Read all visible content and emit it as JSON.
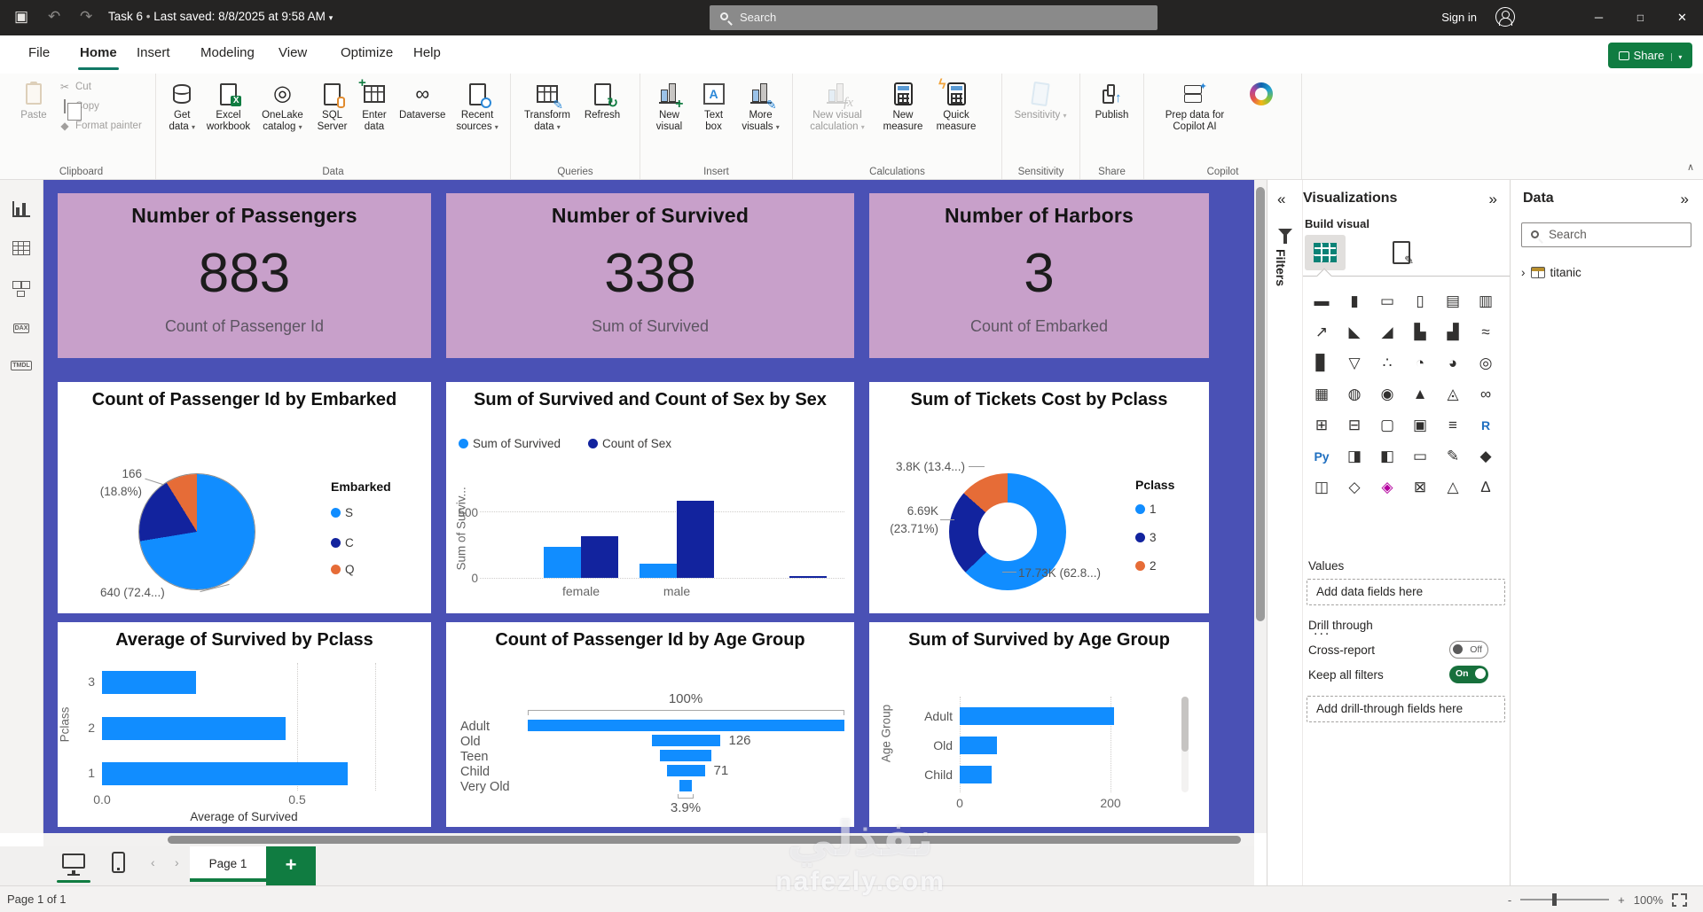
{
  "titlebar": {
    "doc_title": "Task 6",
    "separator": "•",
    "last_saved": "Last saved: 8/8/2025 at 9:58 AM",
    "search_placeholder": "Search",
    "sign_in": "Sign in"
  },
  "menubar": {
    "items": [
      "File",
      "Home",
      "Insert",
      "Modeling",
      "View",
      "Optimize",
      "Help"
    ],
    "active": "Home",
    "share_label": "Share"
  },
  "ribbon": {
    "groups": [
      {
        "label": "Clipboard",
        "buttons": [
          {
            "label": "Paste",
            "icon": "paste",
            "disabled": true
          }
        ],
        "small": [
          {
            "label": "Cut",
            "icon": "cut"
          },
          {
            "label": "Copy",
            "icon": "copy"
          },
          {
            "label": "Format painter",
            "icon": "brush"
          }
        ]
      },
      {
        "label": "Data",
        "buttons": [
          {
            "label": "Get data",
            "icon": "db",
            "caret": true
          },
          {
            "label": "Excel workbook",
            "icon": "excel"
          },
          {
            "label": "OneLake catalog",
            "icon": "onelake",
            "caret": true
          },
          {
            "label": "SQL Server",
            "icon": "sql"
          },
          {
            "label": "Enter data",
            "icon": "enter"
          },
          {
            "label": "Dataverse",
            "icon": "dataverse"
          },
          {
            "label": "Recent sources",
            "icon": "recent",
            "caret": true
          }
        ]
      },
      {
        "label": "Queries",
        "buttons": [
          {
            "label": "Transform data",
            "icon": "transform",
            "caret": true
          },
          {
            "label": "Refresh",
            "icon": "refresh"
          }
        ]
      },
      {
        "label": "Insert",
        "buttons": [
          {
            "label": "New visual",
            "icon": "newvisual"
          },
          {
            "label": "Text box",
            "icon": "textbox"
          },
          {
            "label": "More visuals",
            "icon": "morevis",
            "caret": true
          }
        ]
      },
      {
        "label": "Calculations",
        "buttons": [
          {
            "label": "New visual calculation",
            "icon": "fx",
            "caret": true,
            "disabled": true
          },
          {
            "label": "New measure",
            "icon": "calc"
          },
          {
            "label": "Quick measure",
            "icon": "quick"
          }
        ]
      },
      {
        "label": "Sensitivity",
        "buttons": [
          {
            "label": "Sensitivity",
            "icon": "tag",
            "caret": true,
            "disabled": true
          }
        ]
      },
      {
        "label": "Share",
        "buttons": [
          {
            "label": "Publish",
            "icon": "publish"
          }
        ]
      },
      {
        "label": "Copilot",
        "buttons": [
          {
            "label": "Prep data for Copilot AI",
            "icon": "prep"
          },
          {
            "label": "",
            "icon": "copilot"
          }
        ]
      }
    ]
  },
  "sidebar": {
    "views": [
      "report-view",
      "table-view",
      "model-view",
      "dax-query-view",
      "tmdl-view"
    ],
    "active": "report-view",
    "dax_tag": "DAX",
    "tmdl_tag": "TMDL"
  },
  "cards": [
    {
      "title": "Number of Passengers",
      "value": "883",
      "subtitle": "Count of Passenger Id"
    },
    {
      "title": "Number of Survived",
      "value": "338",
      "subtitle": "Sum of Survived"
    },
    {
      "title": "Number of Harbors",
      "value": "3",
      "subtitle": "Count of Embarked"
    }
  ],
  "chart_data": [
    {
      "type": "pie",
      "title": "Count of Passenger Id by Embarked",
      "legend_title": "Embarked",
      "legend_position": "right",
      "categories": [
        "S",
        "C",
        "Q"
      ],
      "values": [
        640,
        166,
        77
      ],
      "percents": [
        72.4,
        18.8,
        8.8
      ],
      "colors": [
        "#118DFF",
        "#12239E",
        "#E66C37"
      ],
      "label_c_line1": "166",
      "label_c_line2": "(18.8%)",
      "label_s": "640 (72.4...)"
    },
    {
      "type": "column",
      "title": "Sum of Survived and Count of Sex by Sex",
      "categories": [
        "female",
        "male",
        ""
      ],
      "ylabel": "Sum of Surviv...",
      "yticks": [
        "500",
        "0"
      ],
      "ylim": [
        0,
        620
      ],
      "grid": true,
      "series": [
        {
          "name": "Sum of Survived",
          "color": "#118DFF",
          "values": [
            233,
            109,
            0
          ]
        },
        {
          "name": "Count of Sex",
          "color": "#12239E",
          "values": [
            314,
            577,
            16
          ]
        }
      ]
    },
    {
      "type": "donut",
      "title": "Sum of Tickets Cost by Pclass",
      "legend_title": "Pclass",
      "legend_position": "right",
      "categories": [
        "1",
        "3",
        "2"
      ],
      "values": [
        17730,
        6690,
        3800
      ],
      "percents": [
        62.8,
        23.71,
        13.4
      ],
      "colors": [
        "#118DFF",
        "#12239E",
        "#E66C37"
      ],
      "label_p1": "17.73K (62.8...)",
      "label_p3a": "6.69K",
      "label_p3b": "(23.71%)",
      "label_p2": "3.8K (13.4...)"
    },
    {
      "type": "bar",
      "title": "Average of Survived by Pclass",
      "categories": [
        "3",
        "2",
        "1"
      ],
      "values": [
        0.24,
        0.47,
        0.63
      ],
      "xticks": [
        "0.0",
        "0.5"
      ],
      "xtick_values": [
        0,
        0.5
      ],
      "xlim": [
        0,
        0.7
      ],
      "grid": true,
      "xlabel": "Average of Survived",
      "ylabel": "Pclass",
      "color": "#118DFF"
    },
    {
      "type": "funnel",
      "title": "Count of Passenger Id by Age Group",
      "categories": [
        "Adult",
        "Old",
        "Teen",
        "Child",
        "Very Old"
      ],
      "values": [
        584,
        126,
        95,
        71,
        23
      ],
      "top_label": "100%",
      "bottom_label": "3.9%",
      "data_labels": [
        "",
        "126",
        "",
        "71",
        ""
      ],
      "color": "#118DFF"
    },
    {
      "type": "bar",
      "title": "Sum of Survived by Age Group",
      "categories": [
        "Adult",
        "Old",
        "Child"
      ],
      "values": [
        205,
        49,
        42
      ],
      "xticks": [
        "0",
        "200"
      ],
      "xtick_values": [
        0,
        200
      ],
      "xlim": [
        0,
        230
      ],
      "grid": true,
      "ylabel": "Age Group",
      "color": "#118DFF",
      "scrollable": true
    }
  ],
  "visualizations_pane": {
    "title": "Visualizations",
    "collapse_icon": "«",
    "expand_icon": "»",
    "filters_label": "Filters",
    "build_visual": "Build visual",
    "gallery": [
      "stacked-bar-chart",
      "stacked-column-chart",
      "clustered-bar-chart",
      "clustered-column-chart",
      "hundred-stacked-bar-chart",
      "hundred-stacked-column-chart",
      "line-chart",
      "area-chart",
      "stacked-area-chart",
      "line-and-stacked-column-chart",
      "line-and-clustered-column-chart",
      "ribbon-chart",
      "waterfall-chart",
      "funnel-chart",
      "scatter-chart",
      "pie-chart",
      "donut-chart",
      "treemap",
      "map",
      "filled-map",
      "shape-map",
      "azure-map",
      "arcgis-map",
      "slicer",
      "table",
      "matrix",
      "card",
      "multi-row-card",
      "kpi",
      "r-script-visual",
      "python-visual",
      "key-influencers",
      "decomposition-tree",
      "qa-visual",
      "smart-narrative",
      "metrics",
      "paginated-report",
      "power-apps",
      "power-automate",
      "q-and-a",
      "custom-visual",
      "get-more-visuals"
    ],
    "gallery_glyphs": [
      "▬",
      "▮",
      "▭",
      "▯",
      "▤",
      "▥",
      "↗",
      "◣",
      "◢",
      "▙",
      "▟",
      "≈",
      "▊",
      "▽",
      "∴",
      "◔",
      "◕",
      "◎",
      "▦",
      "◍",
      "◉",
      "▲",
      "◬",
      "∞",
      "⊞",
      "⊟",
      "▢",
      "▣",
      "≡",
      "R",
      "Py",
      "◨",
      "◧",
      "▭",
      "✎",
      "◆",
      "◫",
      "◇",
      "◈",
      "⊠",
      "△",
      "∆"
    ],
    "ellipsis": "...",
    "values_label": "Values",
    "add_data_fields": "Add data fields here",
    "drill_through": "Drill through",
    "cross_report": "Cross-report",
    "cross_report_state": "Off",
    "keep_all_filters": "Keep all filters",
    "keep_all_filters_state": "On",
    "add_drill_fields": "Add drill-through fields here"
  },
  "data_pane": {
    "title": "Data",
    "expand_icon": "»",
    "search_placeholder": "Search",
    "table_chevron": "›",
    "table_name": "titanic"
  },
  "footer": {
    "page_tab": "Page 1",
    "add_page": "+",
    "prev": "‹",
    "next": "›",
    "status": "Page 1 of 1",
    "zoom_minus": "-",
    "zoom_plus": "+",
    "zoom": "100%"
  },
  "watermark": {
    "line1": "نفذلي",
    "line2": "nafezly.com"
  }
}
